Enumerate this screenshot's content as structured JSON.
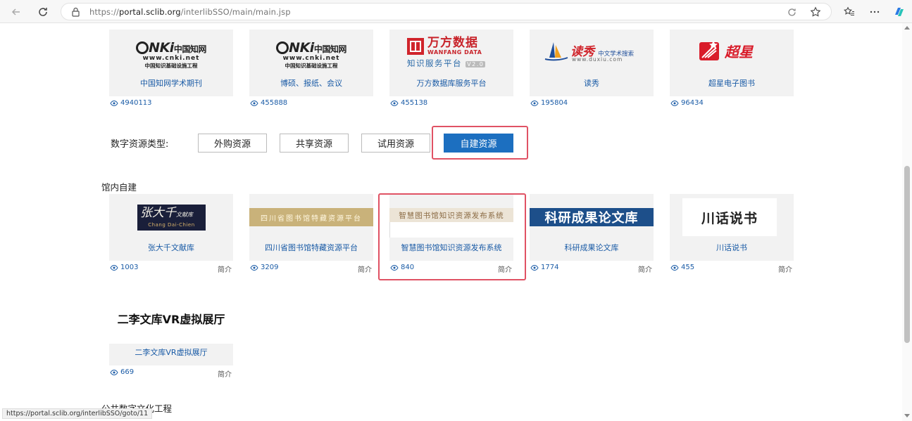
{
  "browser": {
    "url_prefix": "https://",
    "url_host": "portal.sclib.org",
    "url_path": "/interlibSSO/main/main.jsp"
  },
  "top_resources": [
    {
      "title": "中国知网学术期刊",
      "views": "4940113",
      "logo_main": "CNKi中国知网",
      "logo_sub": "www.cnki.net",
      "logo_sub2": "中国知识基础设施工程"
    },
    {
      "title": "博硕、报纸、会议",
      "views": "455888",
      "logo_main": "CNKi中国知网",
      "logo_sub": "www.cnki.net",
      "logo_sub2": "中国知识基础设施工程"
    },
    {
      "title": "万方数据库服务平台",
      "views": "455138",
      "logo_main": "万方数据",
      "logo_sub": "WANFANG DATA",
      "logo_sub2": "知识服务平台",
      "logo_badge": "V2.0"
    },
    {
      "title": "读秀",
      "views": "195804",
      "logo_main": "读秀",
      "logo_sub": "中文学术搜索",
      "logo_sub2": "www.duxiu.com"
    },
    {
      "title": "超星电子图书",
      "views": "96434",
      "logo_main": "超星"
    }
  ],
  "filter": {
    "label": "数字资源类型:",
    "options": [
      "外购资源",
      "共享资源",
      "试用资源",
      "自建资源"
    ],
    "active": "自建资源"
  },
  "section_inhouse": {
    "title": "馆内自建",
    "items": [
      {
        "title": "张大千文献库",
        "views": "1003",
        "intro": "简介",
        "logo_main": "张大千",
        "logo_small": "文献库",
        "logo_sub": "Chang Dai-Chien"
      },
      {
        "title": "四川省图书馆特藏资源平台",
        "views": "3209",
        "intro": "简介",
        "logo_main": "四川省图书馆特藏资源平台"
      },
      {
        "title": "智慧图书馆知识资源发布系统",
        "views": "840",
        "intro": "简介",
        "logo_main": "智慧图书馆知识资源发布系统"
      },
      {
        "title": "科研成果论文库",
        "views": "1774",
        "intro": "简介",
        "logo_main": "科研成果论文库"
      },
      {
        "title": "川话说书",
        "views": "455",
        "intro": "简介",
        "logo_main": "川话说书"
      }
    ]
  },
  "vr_item": {
    "logo_main": "二李文库VR虚拟展厅",
    "title": "二李文库VR虚拟展厅",
    "views": "669",
    "intro": "简介"
  },
  "section_public": {
    "title": "公共数字文化工程"
  },
  "status_url": "https://portal.sclib.org/interlibSSO/goto/11",
  "colors": {
    "accent": "#1c6fc0",
    "highlight": "#e05264",
    "link": "#1a5ba6"
  }
}
